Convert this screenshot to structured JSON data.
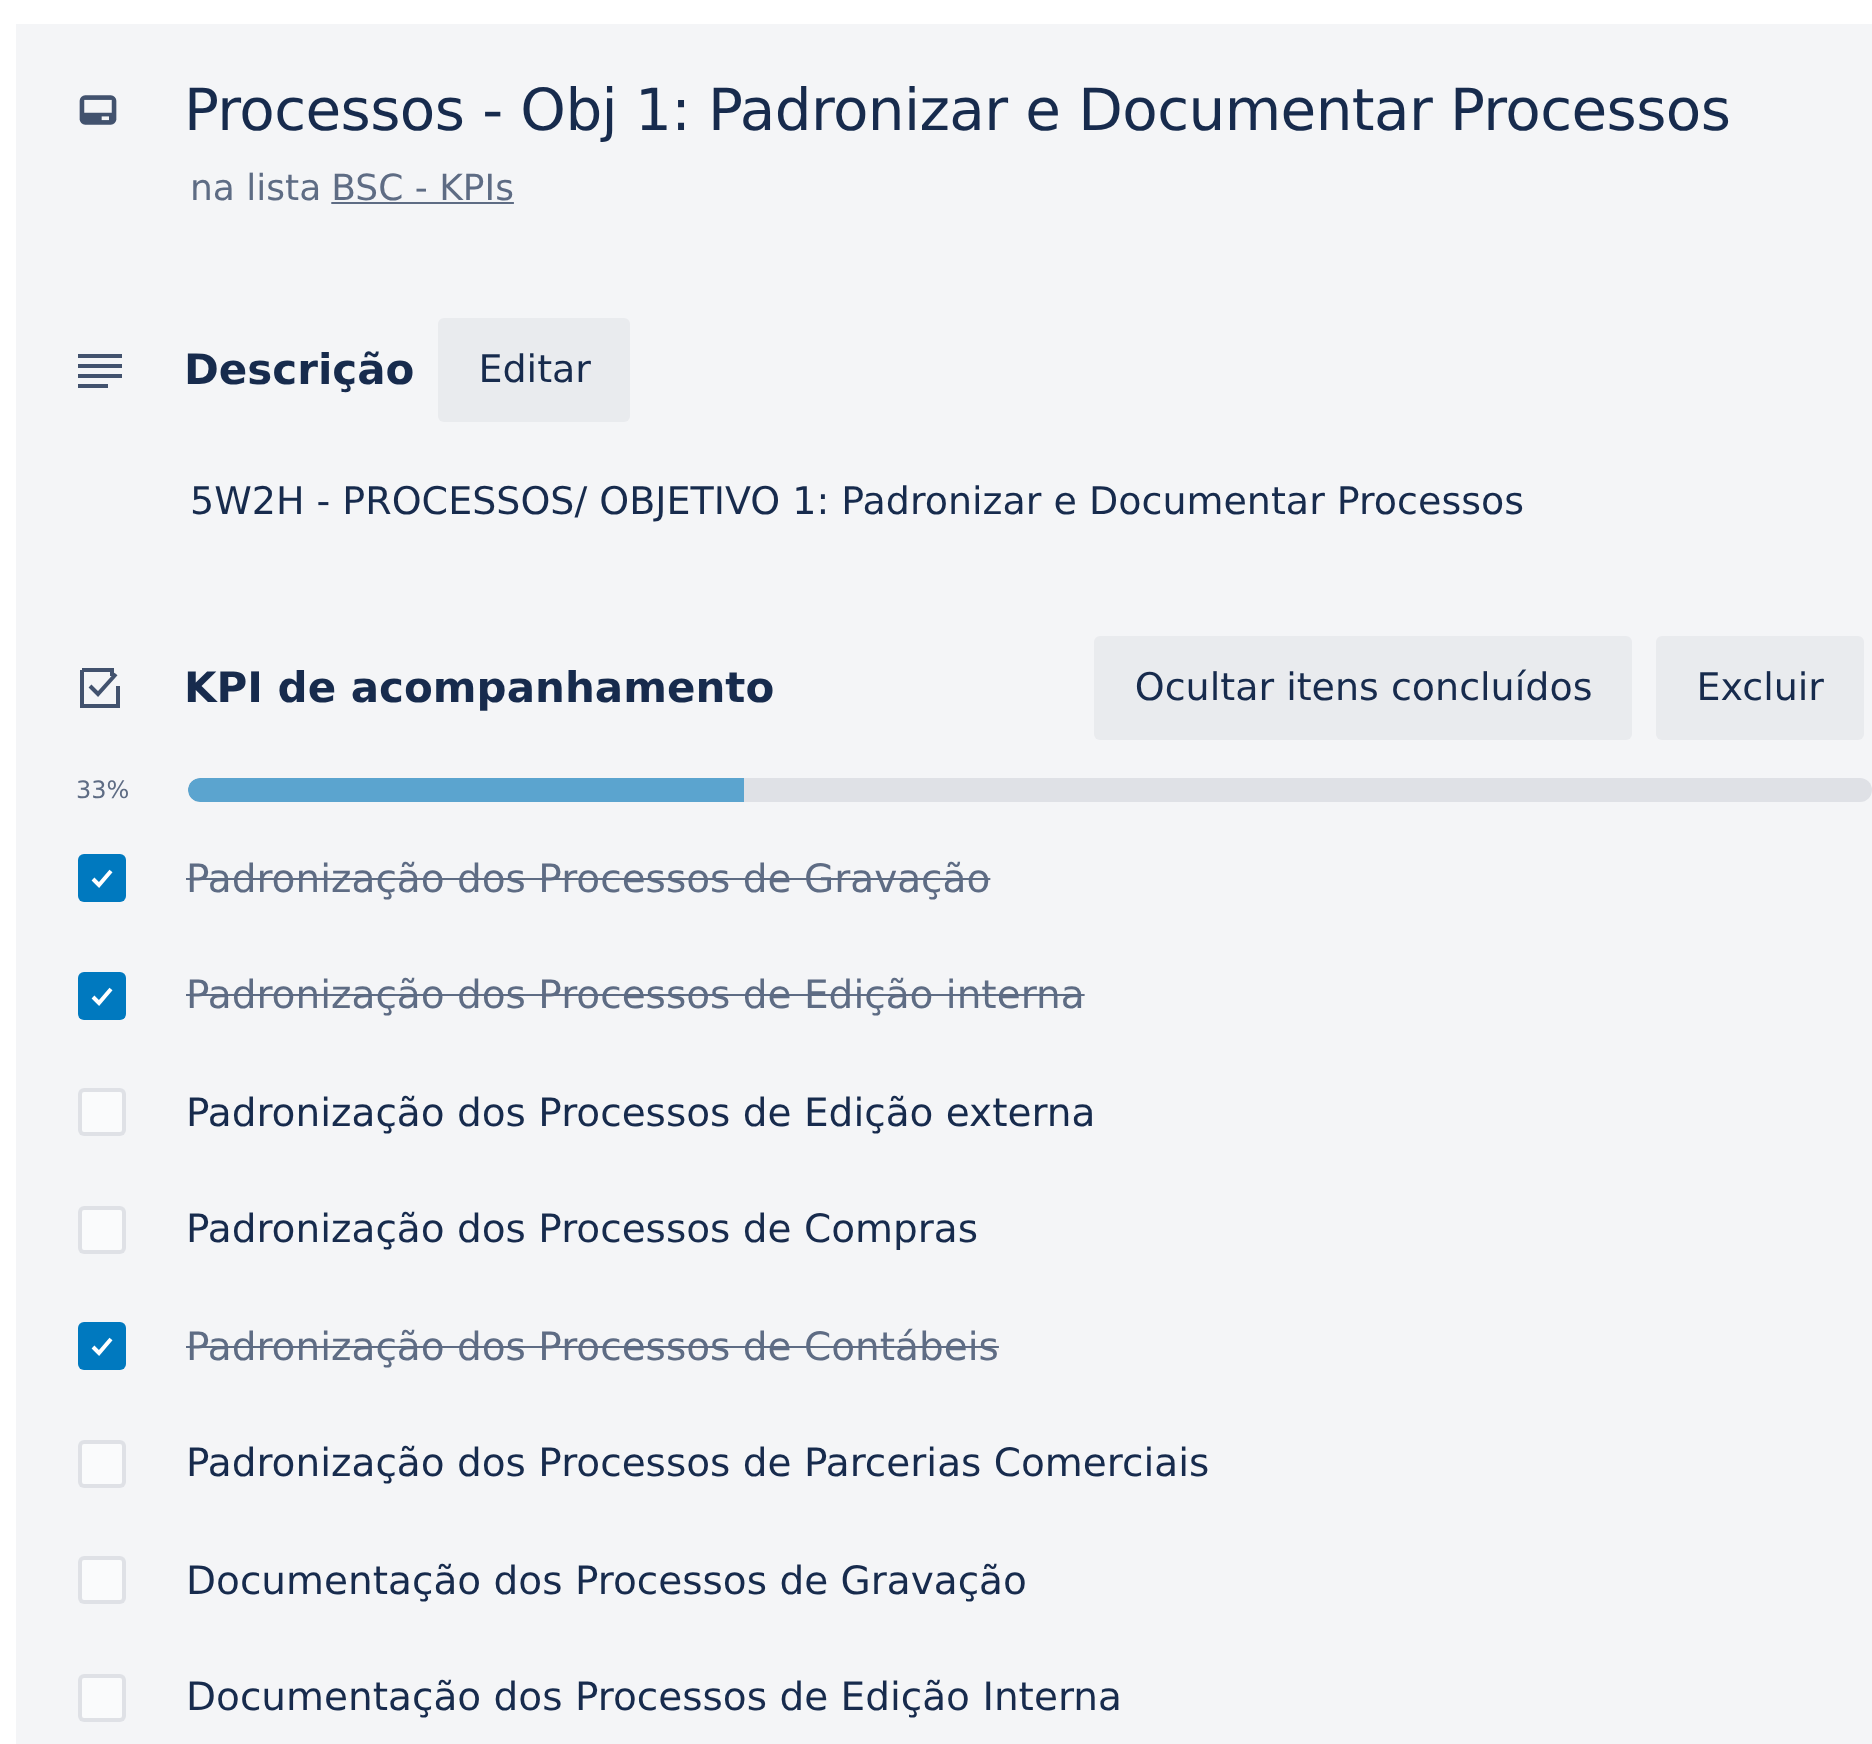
{
  "card": {
    "title": "Processos - Obj 1: Padronizar e Documentar Processos",
    "list_prefix": "na lista",
    "list_link": "BSC - KPIs"
  },
  "description": {
    "heading": "Descrição",
    "edit_button": "Editar",
    "text": "5W2H - PROCESSOS/ OBJETIVO 1: Padronizar e Documentar Processos"
  },
  "checklist": {
    "heading": "KPI de acompanhamento",
    "hide_button": "Ocultar itens concluídos",
    "delete_button": "Excluir",
    "percent": "33%",
    "level": 0.33,
    "items": [
      {
        "label": "Padronização dos Processos de Gravação",
        "checked": true
      },
      {
        "label": "Padronização dos Processos de Edição interna",
        "checked": true
      },
      {
        "label": "Padronização dos Processos de Edição externa",
        "checked": false
      },
      {
        "label": "Padronização dos Processos de Compras",
        "checked": false
      },
      {
        "label": "Padronização dos Processos de Contábeis",
        "checked": true
      },
      {
        "label": "Padronização dos Processos de Parcerias Comerciais",
        "checked": false
      },
      {
        "label": "Documentação dos Processos de Gravação",
        "checked": false
      },
      {
        "label": "Documentação dos Processos de Edição Interna",
        "checked": false
      }
    ]
  }
}
